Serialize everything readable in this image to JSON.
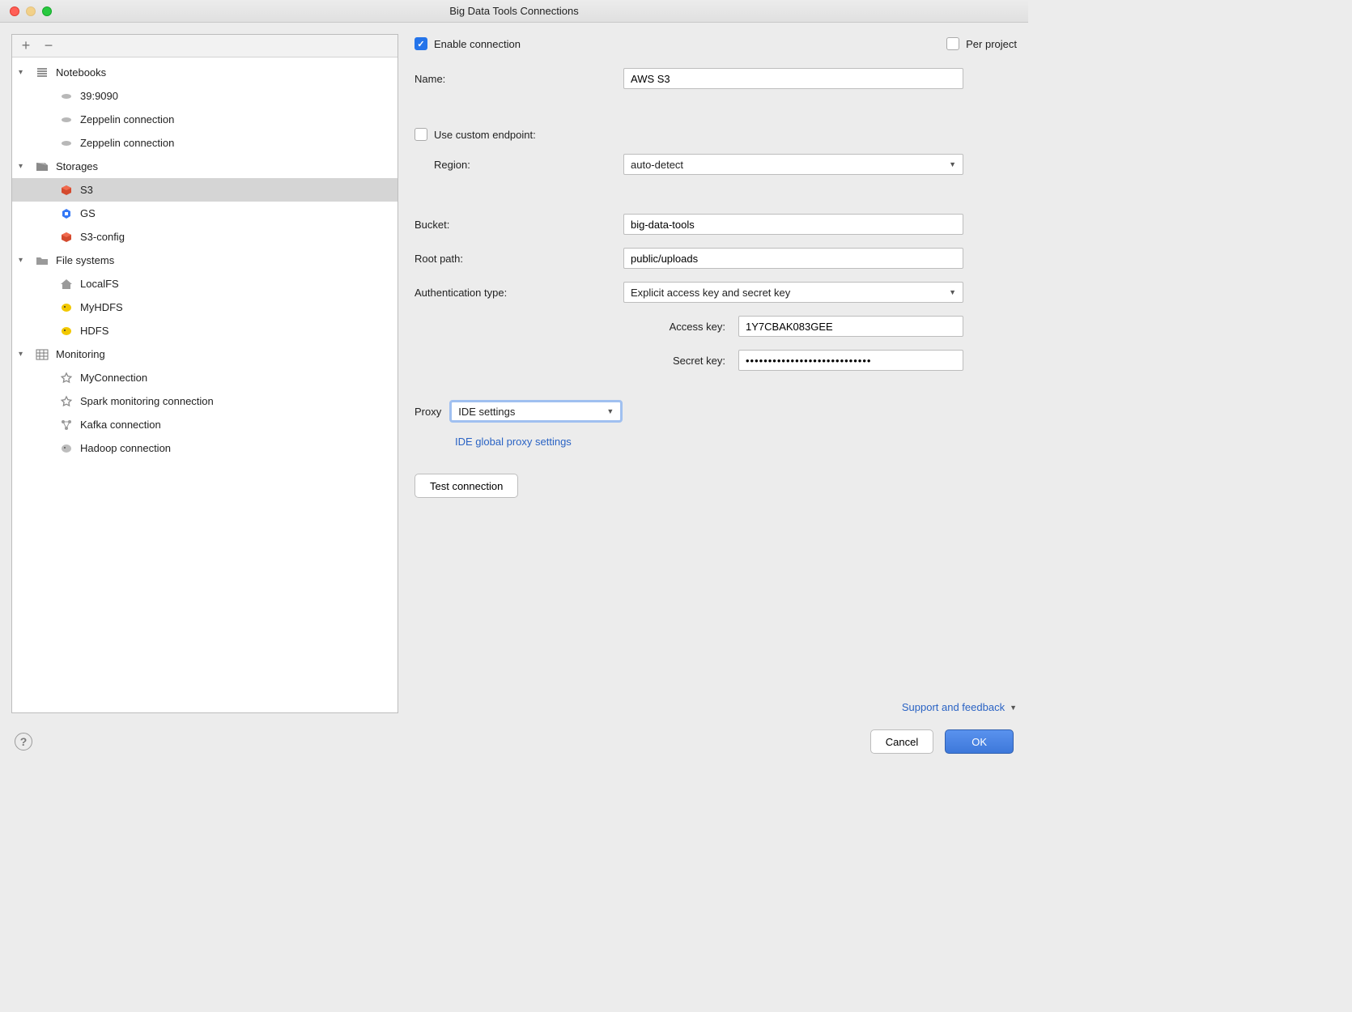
{
  "window": {
    "title": "Big Data Tools Connections"
  },
  "sidebar": {
    "groups": [
      {
        "label": "Notebooks",
        "icon": "lines",
        "items": [
          {
            "label": "39:9090",
            "icon": "disc"
          },
          {
            "label": "Zeppelin connection",
            "icon": "disc"
          },
          {
            "label": "Zeppelin connection",
            "icon": "disc"
          }
        ]
      },
      {
        "label": "Storages",
        "icon": "storage",
        "items": [
          {
            "label": "S3",
            "icon": "cube-red",
            "selected": true
          },
          {
            "label": "GS",
            "icon": "hex-blue"
          },
          {
            "label": "S3-config",
            "icon": "cube-red"
          }
        ]
      },
      {
        "label": "File systems",
        "icon": "folder",
        "items": [
          {
            "label": "LocalFS",
            "icon": "home"
          },
          {
            "label": "MyHDFS",
            "icon": "elephant"
          },
          {
            "label": "HDFS",
            "icon": "elephant"
          }
        ]
      },
      {
        "label": "Monitoring",
        "icon": "grid",
        "items": [
          {
            "label": "MyConnection",
            "icon": "star"
          },
          {
            "label": "Spark monitoring connection",
            "icon": "star"
          },
          {
            "label": "Kafka connection",
            "icon": "nodes"
          },
          {
            "label": "Hadoop connection",
            "icon": "elephant-grey"
          }
        ]
      }
    ]
  },
  "form": {
    "enable_label": "Enable connection",
    "per_project_label": "Per project",
    "name_label": "Name:",
    "name_value": "AWS S3",
    "custom_endpoint_label": "Use custom endpoint:",
    "region_label": "Region:",
    "region_value": "auto-detect",
    "bucket_label": "Bucket:",
    "bucket_value": "big-data-tools",
    "root_path_label": "Root path:",
    "root_path_value": "public/uploads",
    "auth_type_label": "Authentication type:",
    "auth_type_value": "Explicit access key and secret key",
    "access_key_label": "Access key:",
    "access_key_value": "1Y7CBAK083GEE",
    "secret_key_label": "Secret key:",
    "secret_key_value": "••••••••••••••••••••••••••••",
    "proxy_label": "Proxy",
    "proxy_value": "IDE settings",
    "proxy_link": "IDE global proxy settings",
    "test_connection_label": "Test connection",
    "support_label": "Support and feedback"
  },
  "buttons": {
    "cancel": "Cancel",
    "ok": "OK"
  }
}
